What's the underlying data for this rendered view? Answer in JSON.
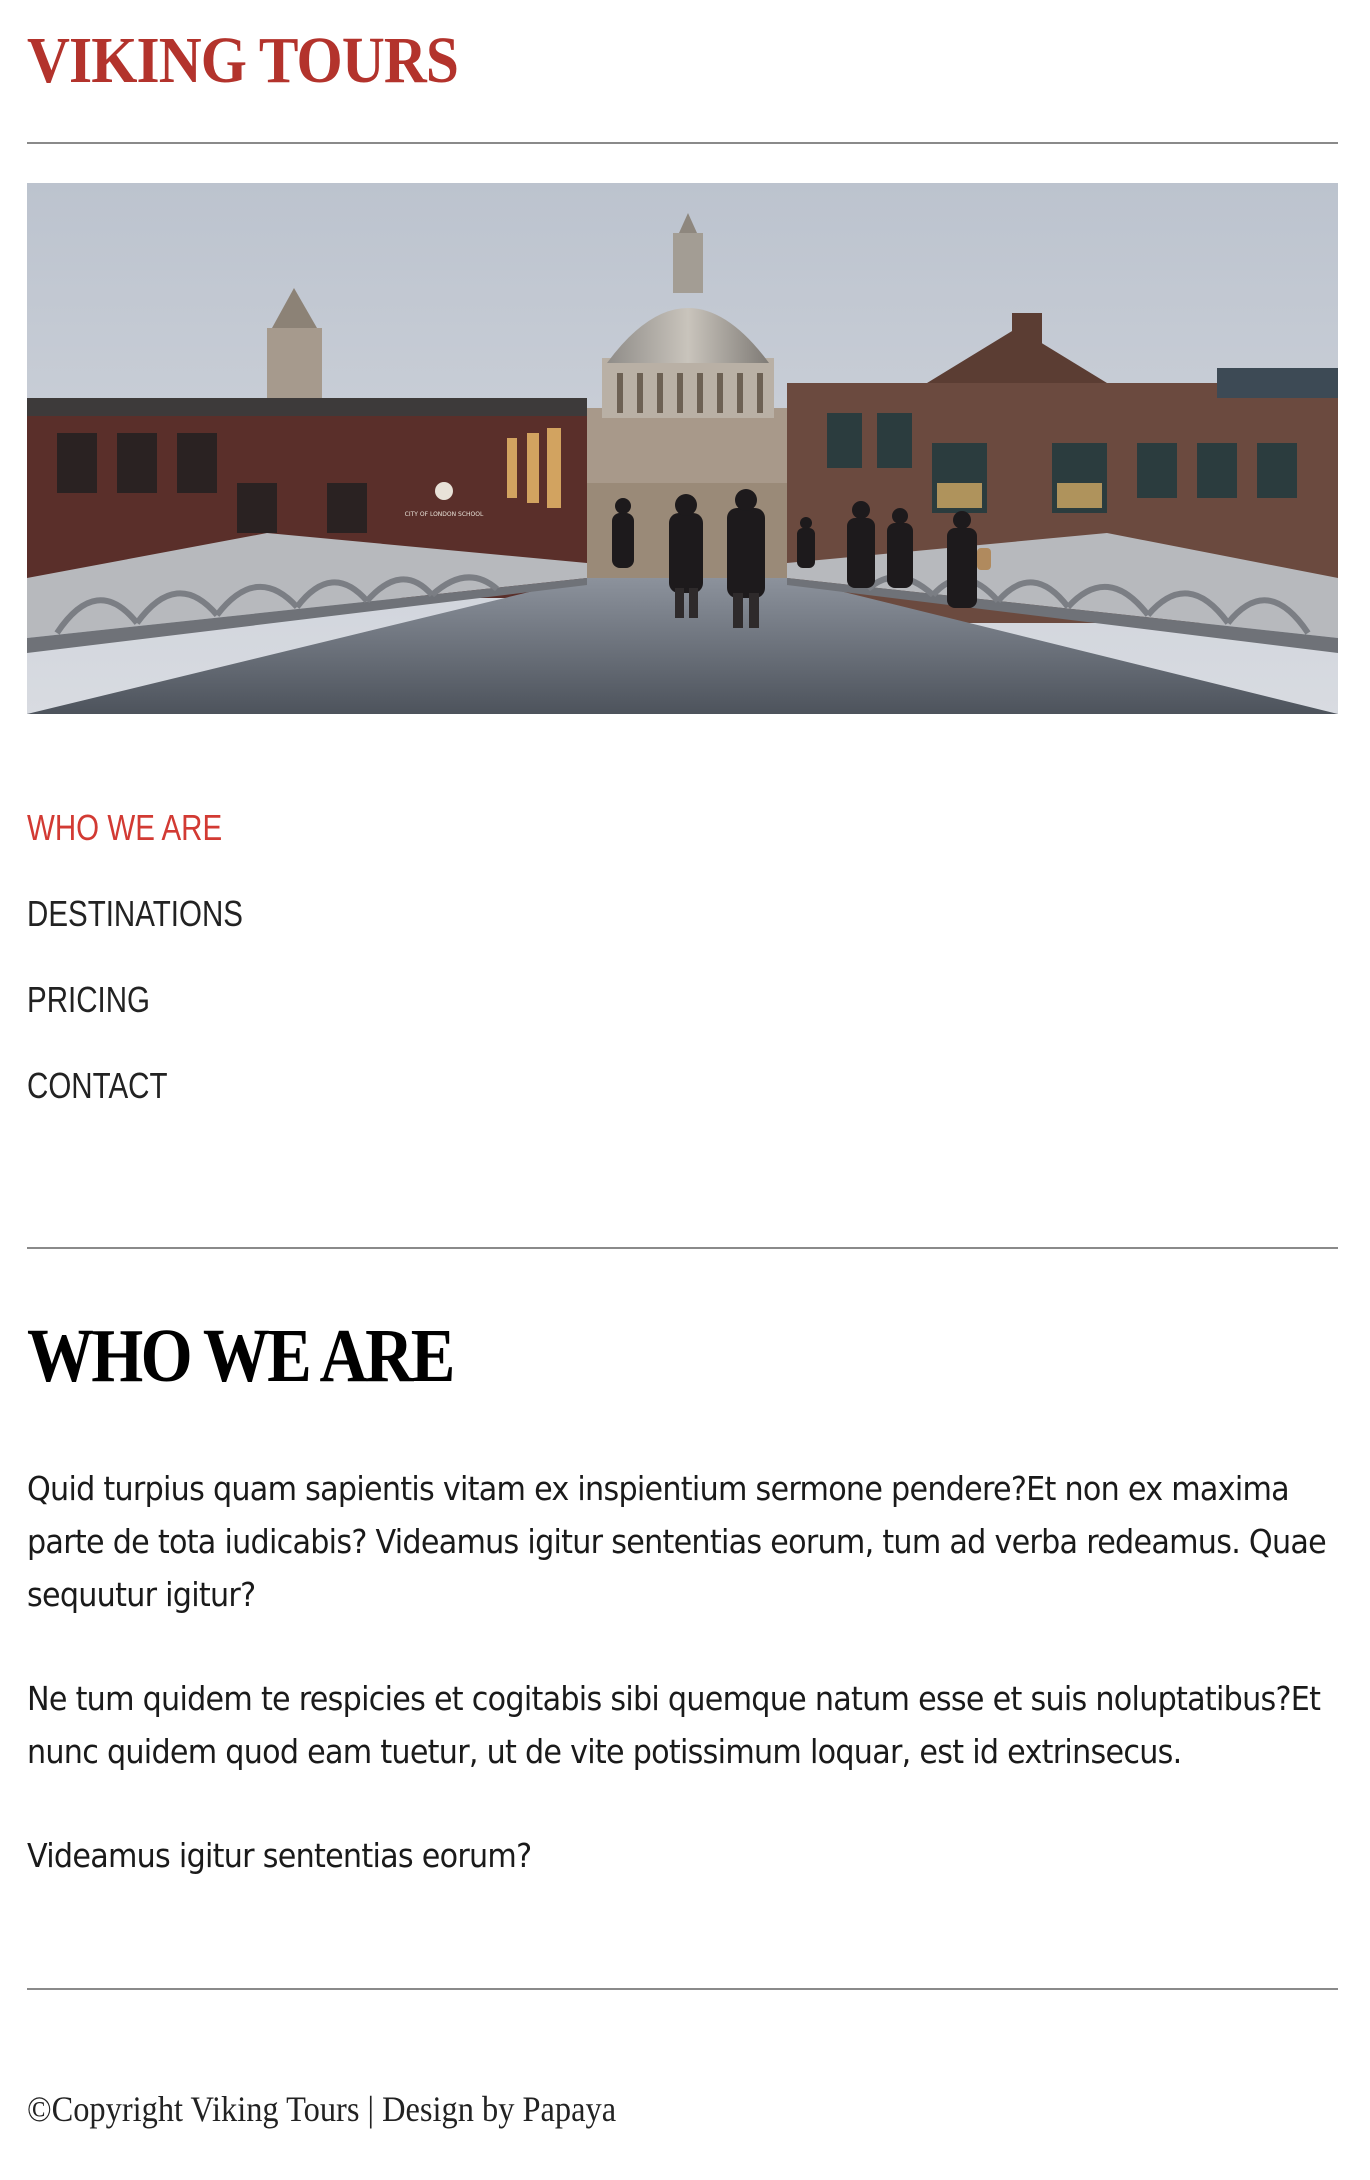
{
  "header": {
    "logo": "VIKING TOURS"
  },
  "hero": {
    "image_alt": "St Paul's Cathedral seen from the Millennium Bridge",
    "sign_text": "CITY OF LONDON SCHOOL"
  },
  "nav": {
    "items": [
      {
        "label": "WHO WE ARE",
        "active": true
      },
      {
        "label": "DESTINATIONS",
        "active": false
      },
      {
        "label": "PRICING",
        "active": false
      },
      {
        "label": "CONTACT",
        "active": false
      }
    ]
  },
  "main": {
    "title": "WHO WE ARE",
    "paragraphs": [
      "Quid turpius quam sapientis vitam ex inspientium sermone pendere?Et non ex maxima parte de tota iudicabis? Videamus igitur sententias eorum, tum ad verba redeamus. Quae sequutur igitur?",
      "Ne tum quidem te respicies et cogitabis sibi quemque natum esse et suis noluptatibus?Et nunc quidem quod eam tuetur, ut de vite potissimum loquar, est id extrinsecus.",
      "Videamus igitur sententias eorum?"
    ]
  },
  "footer": {
    "text": "©Copyright Viking Tours | Design by Papaya"
  },
  "colors": {
    "brand": "#b3332c",
    "active_nav": "#d23a33",
    "text": "#1a1a1a",
    "rule": "#8a8a8a"
  }
}
